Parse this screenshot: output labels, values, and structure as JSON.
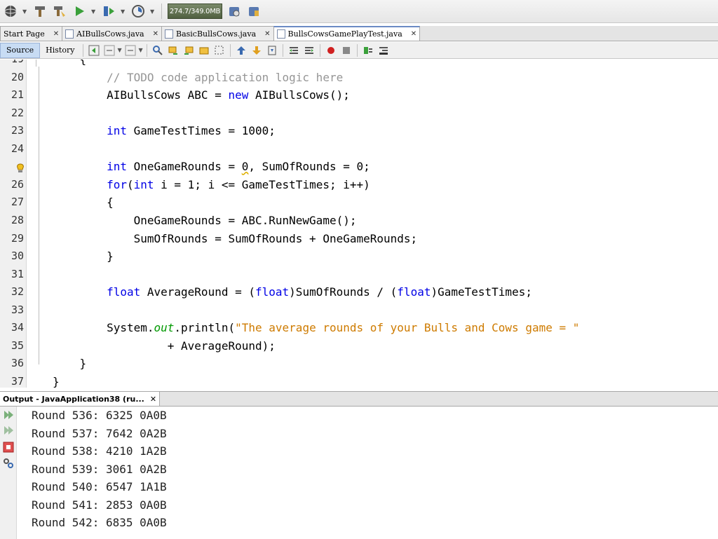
{
  "toolbar": {
    "memory": "274.7/349.0MB"
  },
  "tabs": [
    {
      "label": "Start Page",
      "active": false
    },
    {
      "label": "AIBullsCows.java",
      "active": false
    },
    {
      "label": "BasicBullsCows.java",
      "active": false
    },
    {
      "label": "BullsCowsGamePlayTest.java",
      "active": true
    }
  ],
  "view_tabs": {
    "source": "Source",
    "history": "History"
  },
  "code_lines": [
    {
      "n": "19",
      "parts": [
        [
          "p",
          "    {"
        ]
      ]
    },
    {
      "n": "20",
      "parts": [
        [
          "p",
          "        "
        ],
        [
          "cm",
          "// TODO code application logic here"
        ]
      ]
    },
    {
      "n": "21",
      "parts": [
        [
          "p",
          "        AIBullsCows ABC = "
        ],
        [
          "kw",
          "new"
        ],
        [
          "p",
          " AIBullsCows();"
        ]
      ]
    },
    {
      "n": "22",
      "parts": [
        [
          "p",
          ""
        ]
      ]
    },
    {
      "n": "23",
      "parts": [
        [
          "p",
          "        "
        ],
        [
          "kw",
          "int"
        ],
        [
          "p",
          " GameTestTimes = 1000;"
        ]
      ]
    },
    {
      "n": "24",
      "parts": [
        [
          "p",
          ""
        ]
      ]
    },
    {
      "n": "",
      "parts": [
        [
          "p",
          "        "
        ],
        [
          "kw",
          "int"
        ],
        [
          "p",
          " OneGameRounds = "
        ],
        [
          "warn",
          "0"
        ],
        [
          "p",
          ", SumOfRounds = 0;"
        ]
      ]
    },
    {
      "n": "26",
      "parts": [
        [
          "p",
          "        "
        ],
        [
          "kw",
          "for"
        ],
        [
          "p",
          "("
        ],
        [
          "kw",
          "int"
        ],
        [
          "p",
          " i = 1; i <= GameTestTimes; i++)"
        ]
      ]
    },
    {
      "n": "27",
      "parts": [
        [
          "p",
          "        {"
        ]
      ]
    },
    {
      "n": "28",
      "parts": [
        [
          "p",
          "            OneGameRounds = ABC.RunNewGame();"
        ]
      ]
    },
    {
      "n": "29",
      "parts": [
        [
          "p",
          "            SumOfRounds = SumOfRounds + OneGameRounds;"
        ]
      ]
    },
    {
      "n": "30",
      "parts": [
        [
          "p",
          "        }"
        ]
      ]
    },
    {
      "n": "31",
      "parts": [
        [
          "p",
          ""
        ]
      ]
    },
    {
      "n": "32",
      "parts": [
        [
          "p",
          "        "
        ],
        [
          "kw",
          "float"
        ],
        [
          "p",
          " AverageRound = ("
        ],
        [
          "kw",
          "float"
        ],
        [
          "p",
          ")SumOfRounds / ("
        ],
        [
          "kw",
          "float"
        ],
        [
          "p",
          ")GameTestTimes;"
        ]
      ]
    },
    {
      "n": "33",
      "parts": [
        [
          "p",
          ""
        ]
      ]
    },
    {
      "n": "34",
      "parts": [
        [
          "p",
          "        System."
        ],
        [
          "it",
          "out"
        ],
        [
          "p",
          ".println("
        ],
        [
          "st",
          "\"The average rounds of your Bulls and Cows game = \""
        ]
      ]
    },
    {
      "n": "35",
      "parts": [
        [
          "p",
          "                 + AverageRound);"
        ]
      ]
    },
    {
      "n": "36",
      "parts": [
        [
          "p",
          "    }"
        ]
      ]
    },
    {
      "n": "37",
      "parts": [
        [
          "p",
          "}"
        ]
      ]
    }
  ],
  "output": {
    "title": "Output - JavaApplication38 (ru...",
    "lines": [
      "Round 536: 6325 0A0B",
      "Round 537: 7642 0A2B",
      "Round 538: 4210 1A2B",
      "Round 539: 3061 0A2B",
      "Round 540: 6547 1A1B",
      "Round 541: 2853 0A0B",
      "Round 542: 6835 0A0B"
    ]
  }
}
